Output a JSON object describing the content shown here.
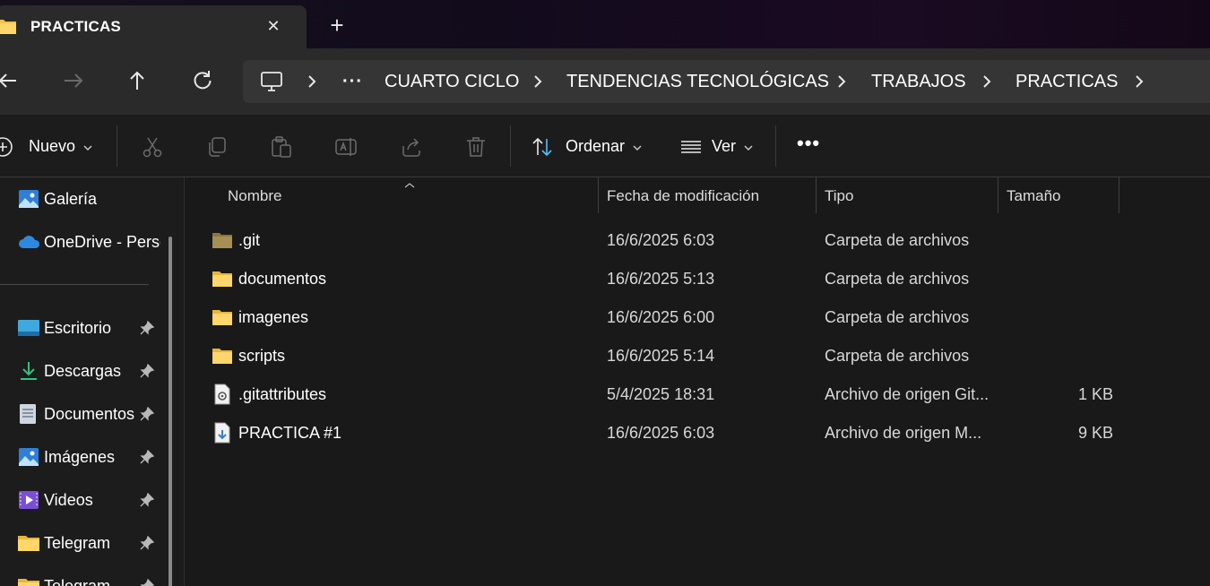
{
  "tab": {
    "title": "PRACTICAS",
    "close_label": "✕",
    "new_tab_label": "+"
  },
  "nav": {
    "back_icon": "arrow-left-icon",
    "forward_icon": "arrow-right-icon",
    "up_icon": "arrow-up-icon",
    "refresh_icon": "refresh-icon",
    "more_label": "···",
    "breadcrumbs": [
      "CUARTO CICLO",
      "TENDENCIAS TECNOLÓGICAS",
      "TRABAJOS",
      "PRACTICAS"
    ]
  },
  "toolbar": {
    "new_label": "Nuevo",
    "sort_label": "Ordenar",
    "view_label": "Ver",
    "more_label": "•••"
  },
  "sidebar": {
    "top_items": [
      {
        "label": "Galería",
        "icon": "gallery-icon"
      },
      {
        "label": "OneDrive - Perso",
        "icon": "onedrive-cloud-icon"
      }
    ],
    "pinned_items": [
      {
        "label": "Escritorio",
        "icon": "desktop-icon"
      },
      {
        "label": "Descargas",
        "icon": "download-icon"
      },
      {
        "label": "Documentos",
        "icon": "documents-icon"
      },
      {
        "label": "Imágenes",
        "icon": "pictures-icon"
      },
      {
        "label": "Videos",
        "icon": "videos-icon"
      },
      {
        "label": "Telegram",
        "icon": "folder-icon"
      },
      {
        "label": "Telegram",
        "icon": "folder-icon"
      }
    ]
  },
  "columns": {
    "name": "Nombre",
    "modified": "Fecha de modificación",
    "type": "Tipo",
    "size": "Tamaño"
  },
  "files": [
    {
      "name": ".git",
      "modified": "16/6/2025 6:03",
      "type": "Carpeta de archivos",
      "size": "",
      "icon": "folder-dim-icon"
    },
    {
      "name": "documentos",
      "modified": "16/6/2025 5:13",
      "type": "Carpeta de archivos",
      "size": "",
      "icon": "folder-icon"
    },
    {
      "name": "imagenes",
      "modified": "16/6/2025 6:00",
      "type": "Carpeta de archivos",
      "size": "",
      "icon": "folder-icon"
    },
    {
      "name": "scripts",
      "modified": "16/6/2025 5:14",
      "type": "Carpeta de archivos",
      "size": "",
      "icon": "folder-icon"
    },
    {
      "name": ".gitattributes",
      "modified": "5/4/2025 18:31",
      "type": "Archivo de origen Git...",
      "size": "1 KB",
      "icon": "settings-file-icon"
    },
    {
      "name": "PRACTICA #1",
      "modified": "16/6/2025 6:03",
      "type": "Archivo de origen M...",
      "size": "9 KB",
      "icon": "markdown-file-icon"
    }
  ],
  "colors": {
    "folder": "#f0c24a",
    "accent": "#4cc2ff",
    "background": "#191919"
  }
}
